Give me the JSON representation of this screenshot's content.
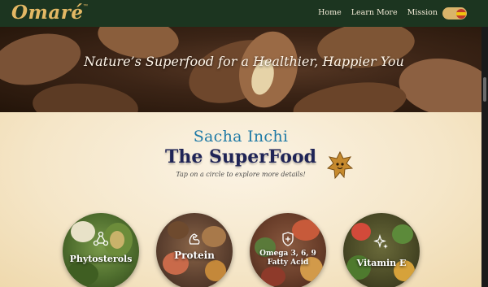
{
  "brand": {
    "name": "Omaré",
    "tm": "™"
  },
  "nav": {
    "links": [
      {
        "label": "Home"
      },
      {
        "label": "Learn More"
      },
      {
        "label": "Mission"
      }
    ],
    "toggle_icon": "flag-toggle-icon"
  },
  "hero": {
    "title": "Nature’s Superfood for a Healthier, Happier You"
  },
  "section": {
    "title": "Sacha Inchi",
    "subtitle": "The SuperFood",
    "hint": "Tap on a circle to explore more details!"
  },
  "circles": [
    {
      "label": "Phytosterols",
      "icon": "molecule-icon"
    },
    {
      "label": "Protein",
      "icon": "muscle-icon"
    },
    {
      "label_line1": "Omega 3, 6, 9",
      "label_line2": "Fatty Acid",
      "icon": "heart-shield-icon"
    },
    {
      "label": "Vitamin E",
      "icon": "sparkle-icon"
    }
  ],
  "colors": {
    "nav_bg": "#1c3520",
    "brand_gold": "#e3b864",
    "title_blue": "#1f7aa6",
    "subtitle_navy": "#1f2456"
  }
}
